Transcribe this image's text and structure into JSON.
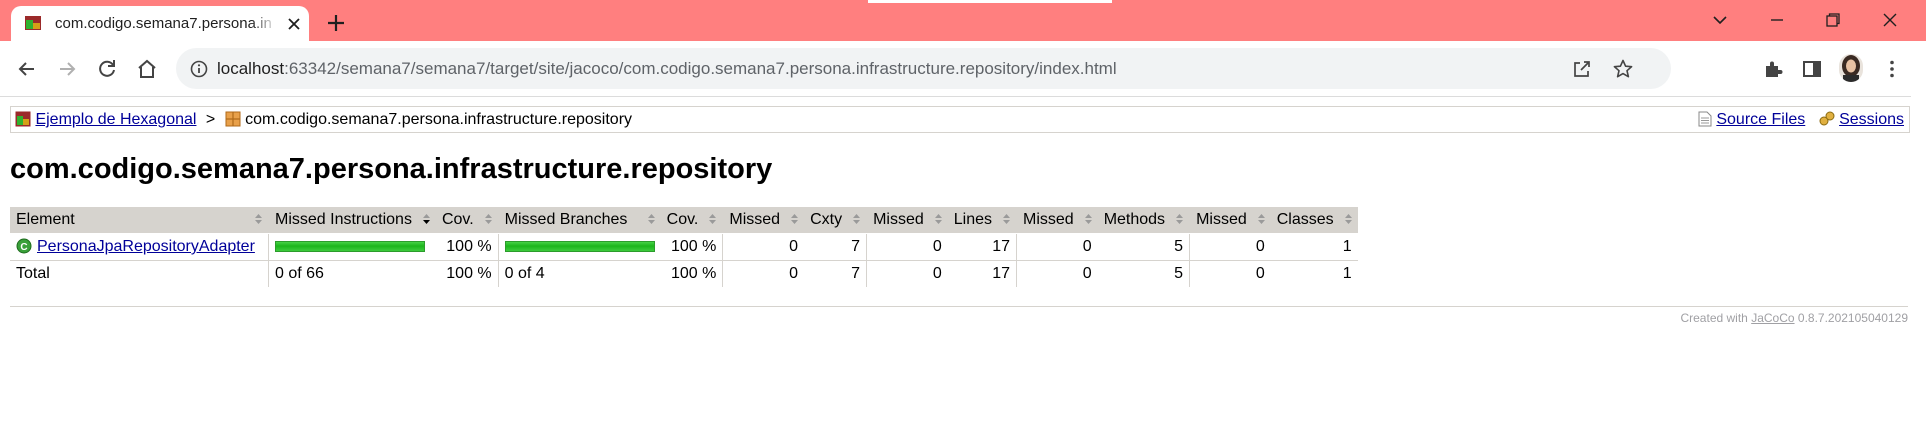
{
  "browser": {
    "tab_title": "com.codigo.semana7.persona.in",
    "url_host": "localhost",
    "url_rest": ":63342/semana7/semana7/target/site/jacoco/com.codigo.semana7.persona.infrastructure.repository/index.html",
    "icons": [
      "back-icon",
      "forward-icon",
      "reload-icon",
      "home-icon",
      "info-icon",
      "share-icon",
      "star-icon",
      "extensions-icon",
      "side-panel-icon",
      "avatar",
      "menu-icon"
    ]
  },
  "breadcrumb": {
    "root_link": "Ejemplo de Hexagonal",
    "separator": ">",
    "current": "com.codigo.semana7.persona.infrastructure.repository",
    "source_files": "Source Files",
    "sessions": "Sessions"
  },
  "page_title": "com.codigo.semana7.persona.infrastructure.repository",
  "table": {
    "headers": [
      "Element",
      "Missed Instructions",
      "Cov.",
      "Missed Branches",
      "Cov.",
      "Missed",
      "Cxty",
      "Missed",
      "Lines",
      "Missed",
      "Methods",
      "Missed",
      "Classes"
    ],
    "rows": [
      {
        "element": "PersonaJpaRepositoryAdapter",
        "instr_covered_fraction": 1.0,
        "instr_cov": "100 %",
        "branch_covered_fraction": 1.0,
        "branch_cov": "100 %",
        "missed_cxty": "0",
        "cxty": "7",
        "missed_lines": "0",
        "lines": "17",
        "missed_methods": "0",
        "methods": "5",
        "missed_classes": "0",
        "classes": "1"
      }
    ],
    "total": {
      "label": "Total",
      "missed_instructions": "0 of 66",
      "instr_cov": "100 %",
      "missed_branches": "0 of 4",
      "branch_cov": "100 %",
      "missed_cxty": "0",
      "cxty": "7",
      "missed_lines": "0",
      "lines": "17",
      "missed_methods": "0",
      "methods": "5",
      "missed_classes": "0",
      "classes": "1"
    }
  },
  "footer": {
    "created_with": "Created with",
    "jacoco": "JaCoCo",
    "version": "0.8.7.202105040129"
  },
  "colors": {
    "titlebar": "#ff7f7f",
    "link": "#000099",
    "coverage_green": "#1bb51b",
    "header_bg": "#d6d3ce"
  }
}
